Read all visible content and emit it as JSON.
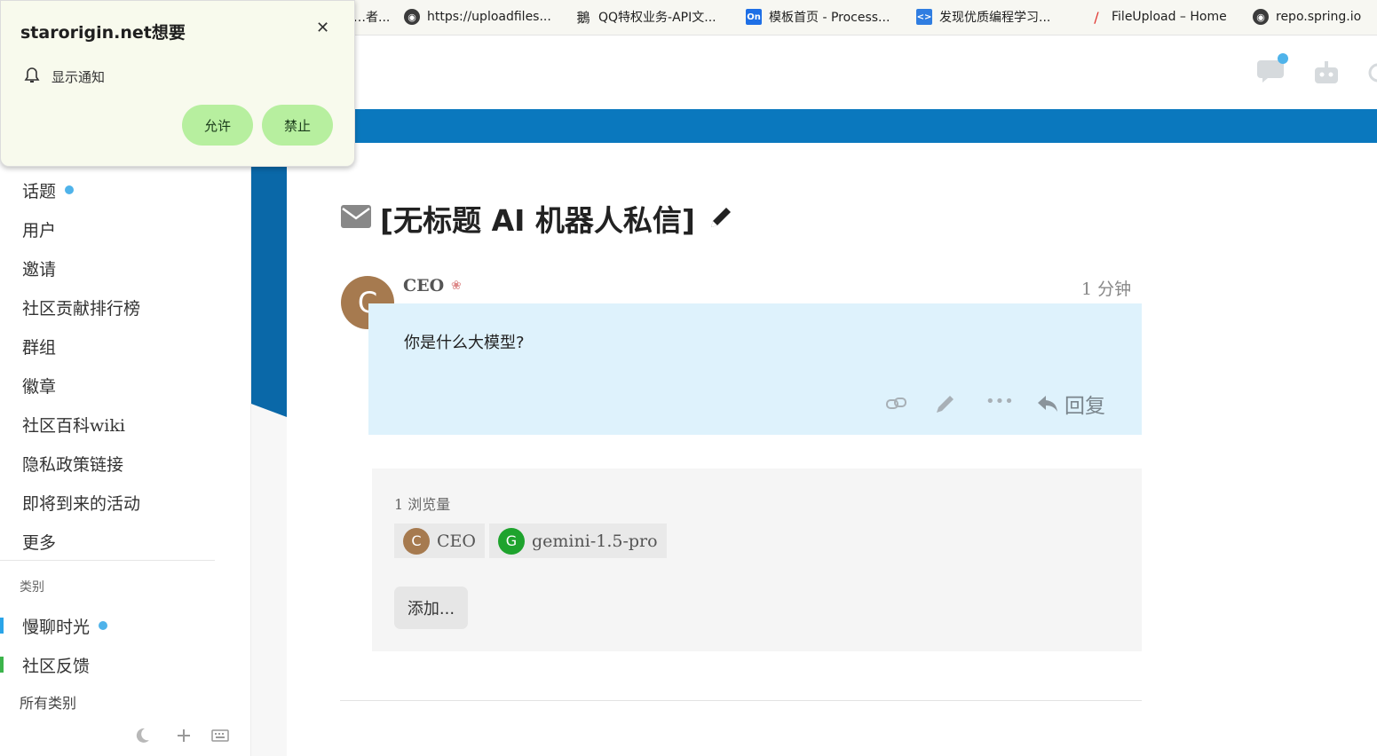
{
  "bookmarks": [
    {
      "label": "…者...",
      "icon": "truncated"
    },
    {
      "label": "https://uploadfiles...",
      "icon": "globe-icon"
    },
    {
      "label": "QQ特权业务-API文...",
      "icon": "qq-icon"
    },
    {
      "label": "模板首页 - Process...",
      "icon": "processon-icon"
    },
    {
      "label": "发现优质编程学习...",
      "icon": "code-icon"
    },
    {
      "label": "FileUpload – Home",
      "icon": "feather-icon"
    },
    {
      "label": "repo.spring.io",
      "icon": "globe-icon"
    }
  ],
  "notification": {
    "title": "starorigin.net想要",
    "item": "显示通知",
    "allow": "允许",
    "block": "禁止",
    "close": "✕"
  },
  "sidebar": {
    "items": [
      {
        "label": "话题",
        "dot": true
      },
      {
        "label": "用户"
      },
      {
        "label": "邀请"
      },
      {
        "label": "社区贡献排行榜"
      },
      {
        "label": "群组"
      },
      {
        "label": "徽章"
      },
      {
        "label": "社区百科wiki"
      },
      {
        "label": "隐私政策链接"
      },
      {
        "label": "即将到来的活动"
      },
      {
        "label": "更多"
      }
    ],
    "categories_header": "类别",
    "categories": [
      {
        "label": "慢聊时光",
        "dot": true,
        "color": "#2aa4e8"
      },
      {
        "label": "社区反馈",
        "color": "#3cb44b"
      }
    ],
    "all_categories": "所有类别"
  },
  "topic": {
    "title": "[无标题 AI 机器人私信]",
    "post": {
      "author": "CEO",
      "author_initial": "C",
      "time": "1 分钟",
      "content": "你是什么大模型?",
      "reply": "回复"
    },
    "views": "1 浏览量",
    "participants": [
      {
        "initial": "C",
        "name": "CEO",
        "color": "#a67a4f"
      },
      {
        "initial": "G",
        "name": "gemini-1.5-pro",
        "color": "#1ea32d"
      }
    ],
    "add_button": "添加..."
  },
  "colors": {
    "banner": "#0a78be",
    "post_bg": "#def2fc",
    "allow_btn": "#b7ef9f",
    "accent_dot": "#4fb3ea"
  }
}
